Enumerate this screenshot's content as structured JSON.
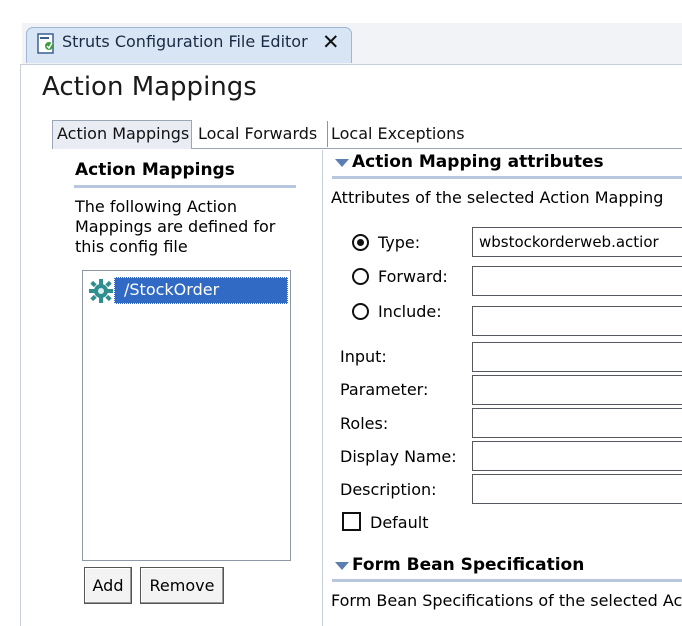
{
  "editor_tab": {
    "label": "Struts Configuration File Editor",
    "close": "✕"
  },
  "page_title": "Action Mappings",
  "subtabs": [
    {
      "label": "Action Mappings",
      "active": true
    },
    {
      "label": "Local Forwards",
      "active": false
    },
    {
      "label": "Local Exceptions",
      "active": false
    }
  ],
  "left": {
    "heading": "Action Mappings",
    "description": "The following Action Mappings are defined for this config file",
    "items": [
      {
        "label": "/StockOrder",
        "selected": true
      }
    ],
    "add_label": "Add",
    "remove_label": "Remove"
  },
  "attributes": {
    "heading": "Action Mapping attributes",
    "description": "Attributes of the selected Action Mapping",
    "type_label": "Type:",
    "type_value": "wbstockorderweb.actior",
    "forward_label": "Forward:",
    "include_label": "Include:",
    "input_label": "Input:",
    "parameter_label": "Parameter:",
    "roles_label": "Roles:",
    "display_name_label": "Display Name:",
    "description_label": "Description:",
    "default_label": "Default"
  },
  "form_bean": {
    "heading": "Form Bean Specification",
    "description": "Form Bean Specifications of the selected Act"
  },
  "colors": {
    "selection": "#316ac5",
    "section_rule": "#b9c7de",
    "tab_bg": "#d8e5f4"
  }
}
